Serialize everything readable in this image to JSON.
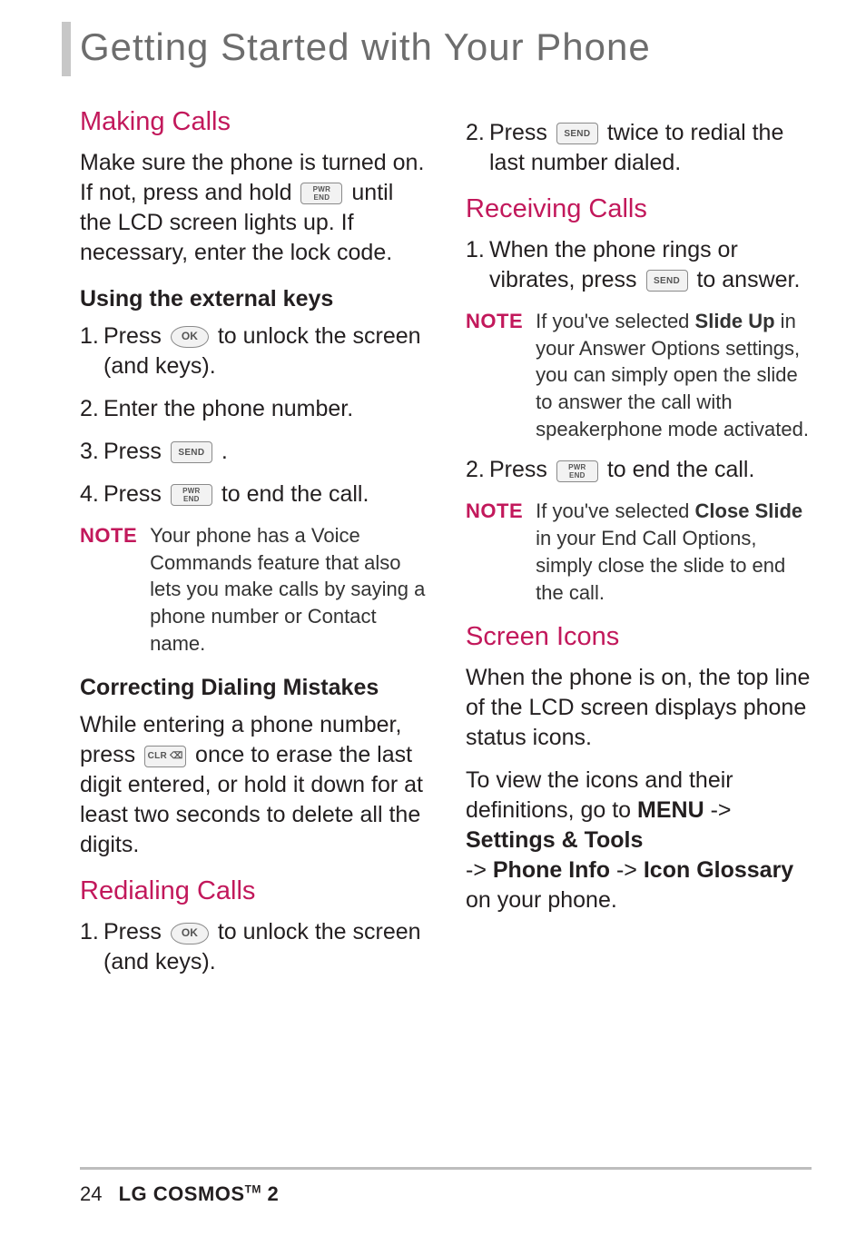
{
  "chapter_title": "Getting Started with Your Phone",
  "keys": {
    "ok": "OK",
    "send": "SEND",
    "end_top": "PWR",
    "end": "END",
    "clr": "CLR"
  },
  "left": {
    "making_calls": {
      "heading": "Making Calls",
      "intro_parts": {
        "a": "Make sure the phone is turned on. If not, press and hold ",
        "b": " until the LCD screen lights up. If necessary, enter the lock code."
      },
      "ext_keys_heading": "Using the external keys",
      "steps": {
        "s1_a": "Press ",
        "s1_b": " to unlock the screen (and keys).",
        "s2": "Enter the phone number.",
        "s3_a": "Press ",
        "s3_b": " .",
        "s4_a": "Press ",
        "s4_b": " to end the call."
      },
      "note_label": "NOTE",
      "note_body": "Your phone has a Voice Commands feature that also lets you make calls by saying a phone number or Contact name.",
      "correcting_heading": "Correcting Dialing Mistakes",
      "correcting_parts": {
        "a": "While entering a phone number, press ",
        "b": " once to erase the last digit entered, or hold it down for at least two seconds to delete all the digits."
      }
    },
    "redial": {
      "heading": "Redialing Calls",
      "s1_a": "Press ",
      "s1_b": " to unlock the screen (and keys)."
    }
  },
  "right": {
    "redial_cont": {
      "s2_a": "Press ",
      "s2_b": " twice to redial the last number dialed."
    },
    "receiving": {
      "heading": "Receiving Calls",
      "s1_a": "When the phone rings or vibrates, press ",
      "s1_b": " to answer.",
      "note1_label": "NOTE",
      "note1_a": "If you've selected ",
      "note1_strong": "Slide Up",
      "note1_b": " in your Answer Options settings, you can simply open the slide to answer the call with speakerphone mode activated.",
      "s2_a": "Press ",
      "s2_b": " to end the call.",
      "note2_label": "NOTE",
      "note2_a": "If you've selected ",
      "note2_strong": "Close Slide",
      "note2_b": " in your End Call Options, simply close the slide to end the call."
    },
    "icons": {
      "heading": "Screen Icons",
      "p1": "When the phone is on, the top line of the LCD screen displays phone status icons.",
      "p2_a": "To view the icons and their definitions, go to ",
      "menu": "MENU",
      "arrow": " -> ",
      "settings": "Settings & Tools",
      "phone_info": "Phone Info",
      "icon_glossary": "Icon Glossary",
      "p2_b": " on your phone."
    }
  },
  "footer": {
    "page": "24",
    "brand_a": "LG COSMOS",
    "tm": "TM",
    "brand_b": " 2"
  }
}
